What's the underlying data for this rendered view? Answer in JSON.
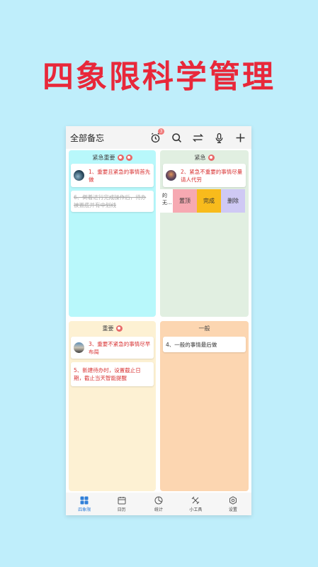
{
  "headline": "四象限科学管理",
  "app": {
    "title": "全部备忘",
    "alarm_badge": "3",
    "icons": [
      "alarm-clock-icon",
      "search-icon",
      "swap-icon",
      "microphone-icon",
      "plus-icon"
    ]
  },
  "quadrants": {
    "q1": {
      "header": "紧急重要",
      "cards": [
        {
          "text": "1、重要且紧急的事情首先做"
        },
        {
          "text": "6、倒着进行完成操作后，待办被置底并有中划线"
        }
      ]
    },
    "q2": {
      "header": "紧急",
      "cards": [
        {
          "text": "2、紧急不重要的事情尽量请人代劳"
        }
      ],
      "swipe": {
        "peek": "的\n无...",
        "actions": [
          "置顶",
          "完成",
          "删除"
        ]
      }
    },
    "q3": {
      "header": "重要",
      "cards": [
        {
          "text": "3、重要不紧急的事情尽早布局"
        },
        {
          "text": "5、新建待办时，设置截止日期，截止当天智能提醒"
        }
      ]
    },
    "q4": {
      "header": "一般",
      "cards": [
        {
          "text": "4、一般的事情最后做"
        }
      ]
    }
  },
  "nav": [
    {
      "label": "四象限",
      "icon": "grid-icon",
      "active": true
    },
    {
      "label": "日历",
      "icon": "calendar-icon",
      "active": false
    },
    {
      "label": "统计",
      "icon": "chart-icon",
      "active": false
    },
    {
      "label": "小工具",
      "icon": "tools-icon",
      "active": false
    },
    {
      "label": "设置",
      "icon": "settings-icon",
      "active": false
    }
  ],
  "colors": {
    "background": "#bfeefb",
    "headline": "#e8283a",
    "q1": "#b8f8fb",
    "q2": "#e1efe1",
    "q3": "#fdf1d3",
    "q4": "#fcd6b1",
    "accent": "#2f7fd8"
  }
}
